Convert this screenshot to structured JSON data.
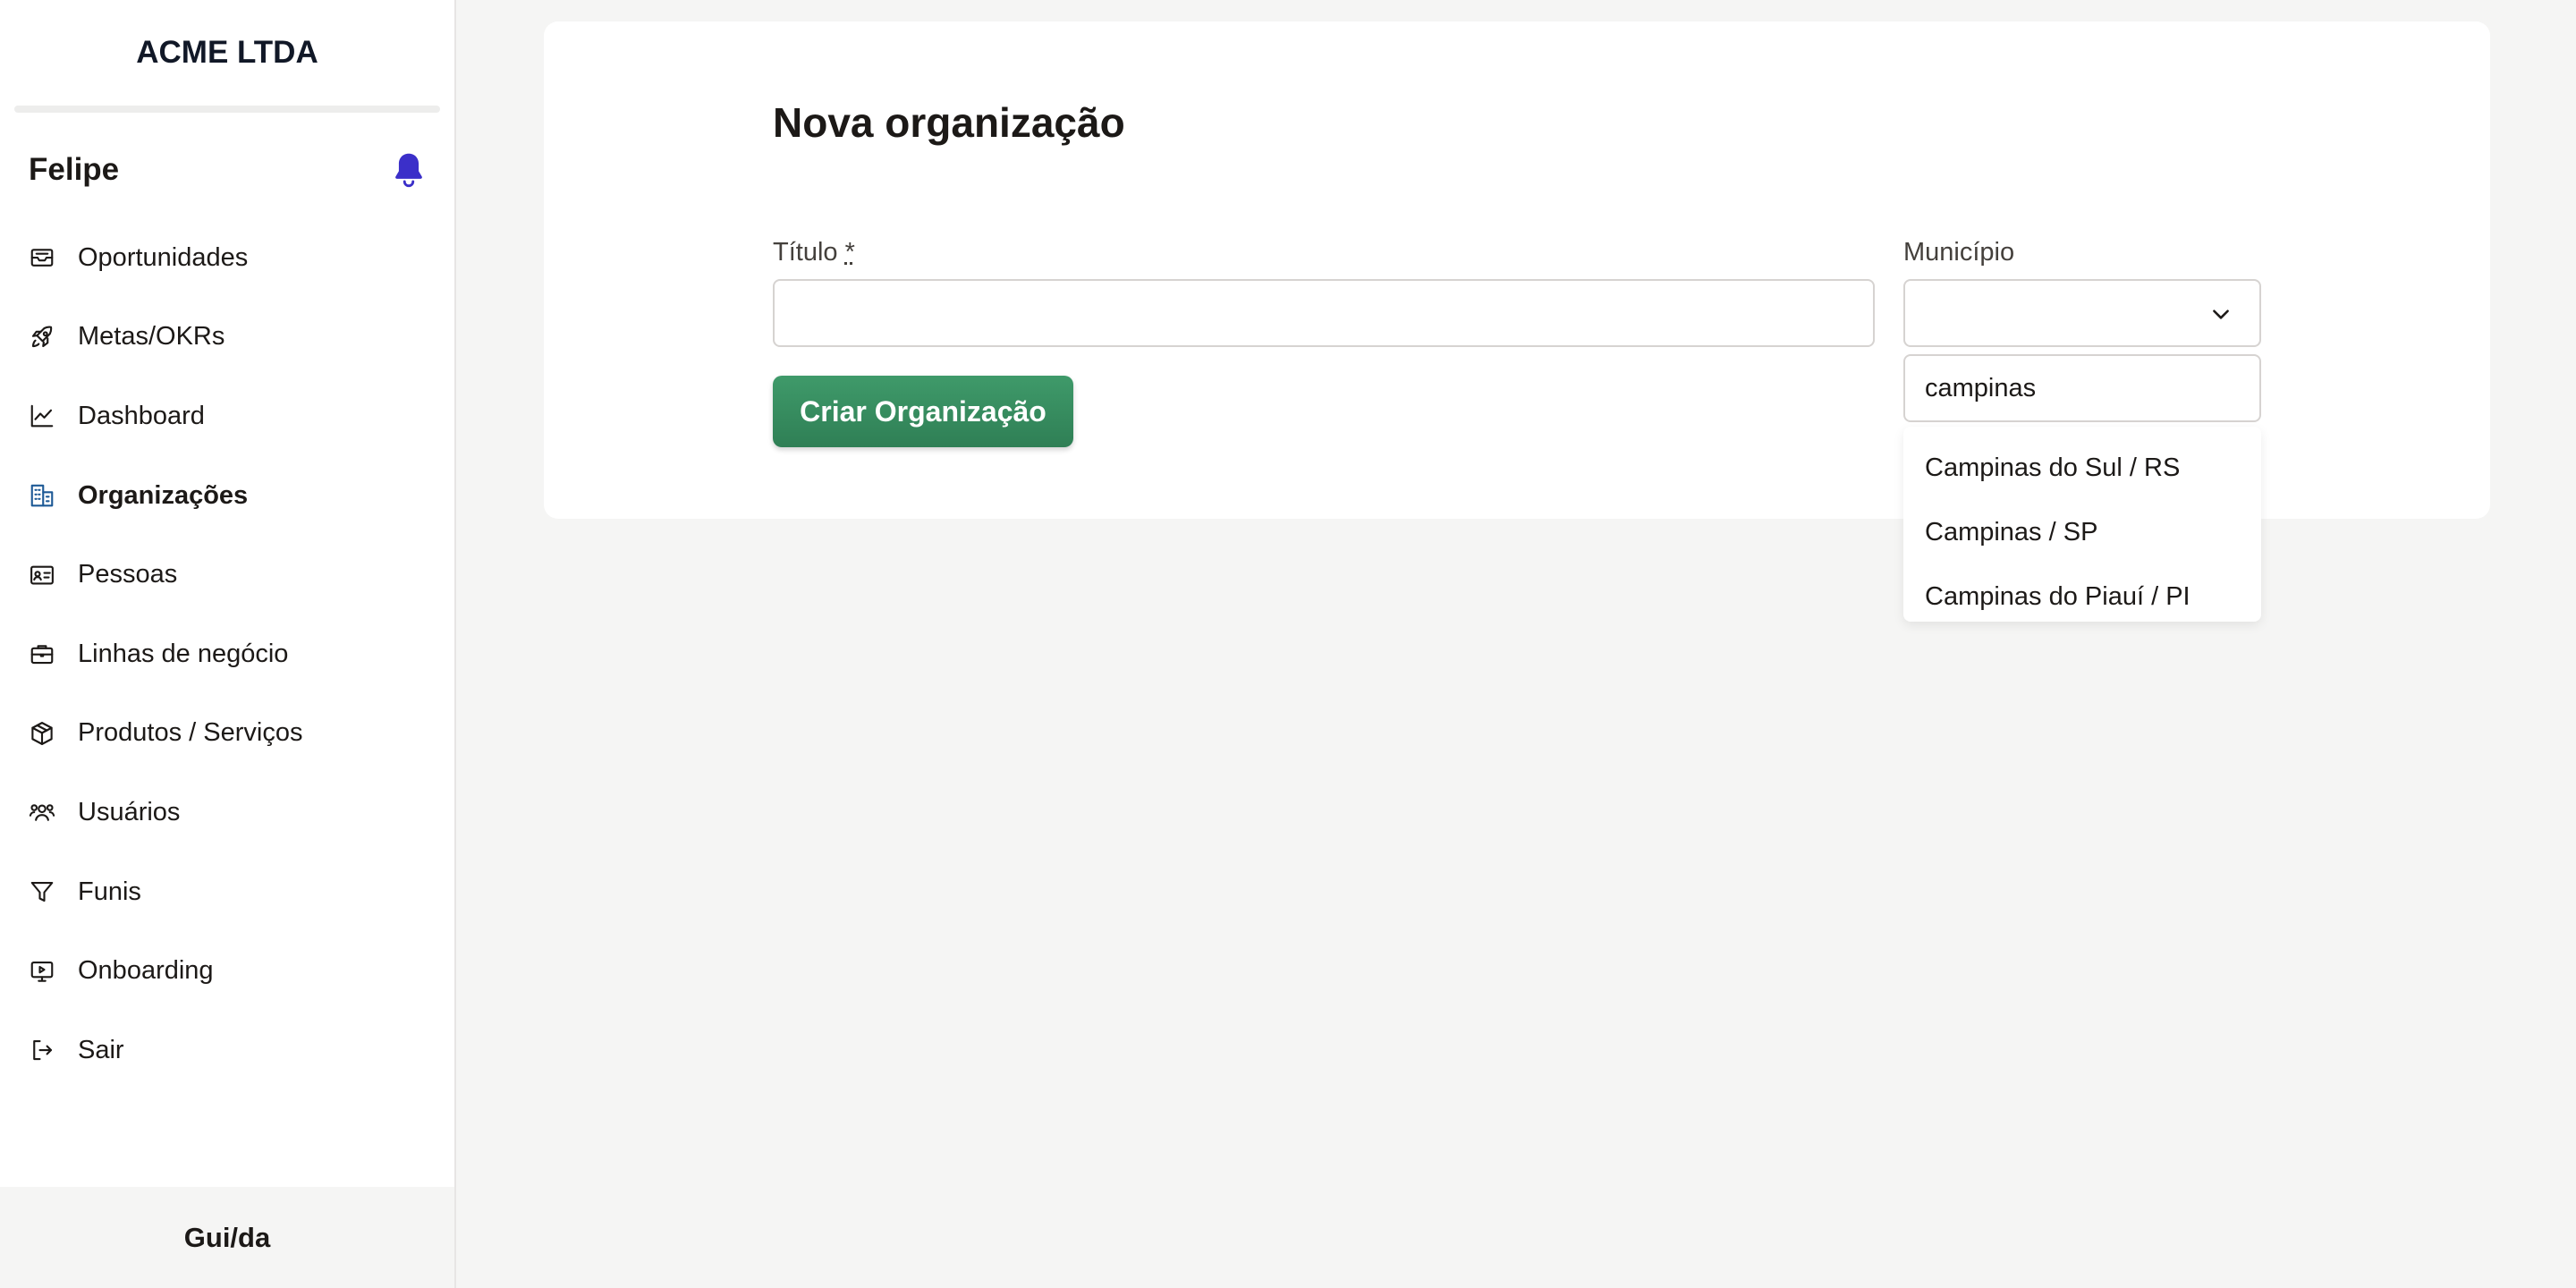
{
  "sidebar": {
    "brand": "ACME LTDA",
    "user_name": "Felipe",
    "items": [
      {
        "label": "Oportunidades",
        "icon": "inbox-icon"
      },
      {
        "label": "Metas/OKRs",
        "icon": "rocket-icon"
      },
      {
        "label": "Dashboard",
        "icon": "line-chart-icon"
      },
      {
        "label": "Organizações",
        "icon": "building-icon",
        "active": true
      },
      {
        "label": "Pessoas",
        "icon": "id-card-icon"
      },
      {
        "label": "Linhas de negócio",
        "icon": "briefcase-icon"
      },
      {
        "label": "Produtos / Serviços",
        "icon": "box-icon"
      },
      {
        "label": "Usuários",
        "icon": "users-icon"
      },
      {
        "label": "Funis",
        "icon": "filter-icon"
      },
      {
        "label": "Onboarding",
        "icon": "play-screen-icon"
      },
      {
        "label": "Sair",
        "icon": "logout-icon"
      }
    ],
    "footer": "Gui/da"
  },
  "form": {
    "title": "Nova organização",
    "titulo_label": "Título",
    "required_mark": "*",
    "titulo_value": "",
    "municipio_label": "Município",
    "municipio_value": "",
    "submit_label": "Criar Organização"
  },
  "dropdown": {
    "search_value": "campinas",
    "options": [
      "Campinas do Sul / RS",
      "Campinas / SP",
      "Campinas do Piauí / PI"
    ]
  },
  "colors": {
    "accent": "#3b2fc9",
    "button": "#3a8f62",
    "active_icon": "#1e5a96"
  }
}
